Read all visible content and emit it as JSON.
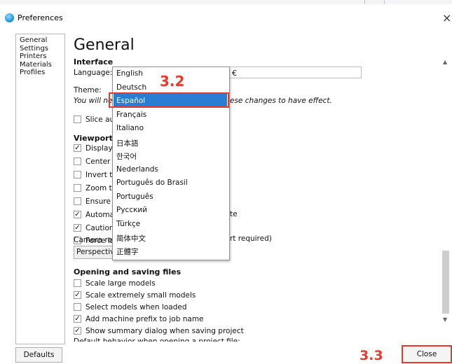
{
  "window": {
    "title": "Preferences",
    "close_glyph": "×",
    "icon": "cura-app-icon"
  },
  "sidebar": {
    "items": [
      {
        "label": "General"
      },
      {
        "label": "Settings"
      },
      {
        "label": "Printers"
      },
      {
        "label": "Materials"
      },
      {
        "label": "Profiles"
      }
    ]
  },
  "main": {
    "heading": "General",
    "interface_section": "Interface",
    "language_label": "Language:",
    "currency_value": "€",
    "theme_label": "Theme:",
    "restart_note_left": "You will ne",
    "restart_note_right": "ese changes to have effect.",
    "slice_auto": "Slice aut",
    "viewport_section": "Viewport l",
    "viewport_items": [
      {
        "label": "Display c",
        "checked": true
      },
      {
        "label": "Center c",
        "checked": false
      },
      {
        "label": "Invert tl",
        "checked": false
      },
      {
        "label": "Zoom tc",
        "checked": false
      },
      {
        "label": "Ensure r",
        "checked": false
      },
      {
        "label": "Automa",
        "checked": true
      },
      {
        "label": "Caution",
        "checked": true
      },
      {
        "label": "Force la",
        "checked": false
      }
    ],
    "automa_tail": "te",
    "force_tail": "rt required)",
    "camera_label": "Camera ren",
    "camera_combo_value": "Perspectiv",
    "files_section": "Opening and saving files",
    "files_items": [
      {
        "label": "Scale large models",
        "checked": false
      },
      {
        "label": "Scale extremely small models",
        "checked": true
      },
      {
        "label": "Select models when loaded",
        "checked": false
      },
      {
        "label": "Add machine prefix to job name",
        "checked": true
      },
      {
        "label": "Show summary dialog when saving project",
        "checked": true
      }
    ],
    "default_behavior": "Default behavior when opening a project file:"
  },
  "language_dropdown": {
    "options": [
      "English",
      "Deutsch",
      "Español",
      "Français",
      "Italiano",
      "日本語",
      "한국어",
      "Nederlands",
      "Português do Brasil",
      "Português",
      "Русский",
      "Türkçe",
      "简体中文",
      "正體字"
    ],
    "selected": "Español"
  },
  "annotations": {
    "step_a": "3.2",
    "step_b": "3.3"
  },
  "buttons": {
    "defaults": "Defaults",
    "close": "Close"
  },
  "colors": {
    "selection": "#2b7cd3",
    "annotation_red": "#e8392b"
  }
}
